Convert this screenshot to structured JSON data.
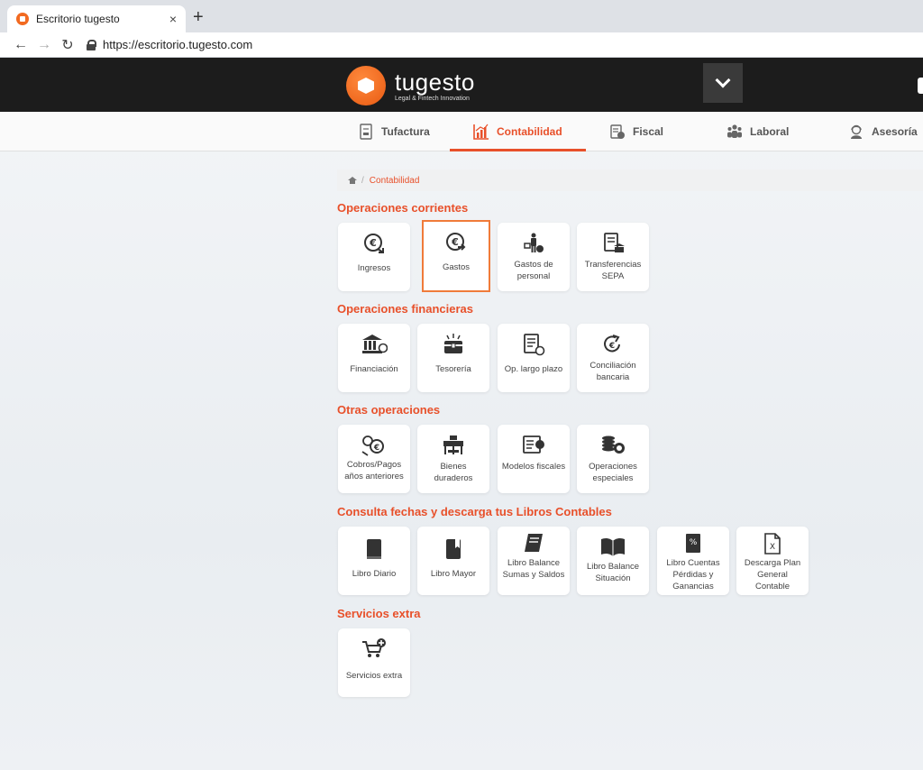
{
  "browser": {
    "tab_title": "Escritorio tugesto",
    "tab_close": "×",
    "new_tab": "+",
    "url": "https://escritorio.tugesto.com",
    "back": "←",
    "forward": "→",
    "reload": "↻"
  },
  "header": {
    "logo_name": "tugesto",
    "logo_tagline": "Legal & Fintech Innovation",
    "accent_color": "#e8502a"
  },
  "modules": [
    {
      "label": "Tufactura",
      "icon": "invoice-icon",
      "active": false
    },
    {
      "label": "Contabilidad",
      "icon": "chart-icon",
      "active": true
    },
    {
      "label": "Fiscal",
      "icon": "fiscal-doc-icon",
      "active": false
    },
    {
      "label": "Laboral",
      "icon": "people-icon",
      "active": false
    },
    {
      "label": "Asesoría",
      "icon": "advisor-icon",
      "active": false
    }
  ],
  "breadcrumb": {
    "current": "Contabilidad"
  },
  "sections": [
    {
      "title": "Operaciones corrientes",
      "items": [
        {
          "label": "Ingresos",
          "icon": "euro-in-icon"
        },
        {
          "label": "Gastos",
          "icon": "euro-out-icon",
          "selected": true
        },
        {
          "label": "Gastos de personal",
          "icon": "personnel-expense-icon"
        },
        {
          "label": "Transferencias SEPA",
          "icon": "sepa-transfer-icon"
        }
      ]
    },
    {
      "title": "Operaciones financieras",
      "items": [
        {
          "label": "Financiación",
          "icon": "bank-icon"
        },
        {
          "label": "Tesorería",
          "icon": "treasury-chest-icon"
        },
        {
          "label": "Op. largo plazo",
          "icon": "long-term-doc-icon"
        },
        {
          "label": "Conciliación bancaria",
          "icon": "reconcile-icon"
        }
      ]
    },
    {
      "title": "Otras operaciones",
      "items": [
        {
          "label": "Cobros/Pagos años anteriores",
          "icon": "previous-years-icon"
        },
        {
          "label": "Bienes duraderos",
          "icon": "durable-goods-icon"
        },
        {
          "label": "Modelos fiscales",
          "icon": "tax-model-icon"
        },
        {
          "label": "Operaciones especiales",
          "icon": "coins-icon"
        }
      ]
    },
    {
      "title": "Consulta fechas y descarga tus Libros Contables",
      "items": [
        {
          "label": "Libro Diario",
          "icon": "book-icon"
        },
        {
          "label": "Libro Mayor",
          "icon": "book-bookmark-icon"
        },
        {
          "label": "Libro Balance Sumas y Saldos",
          "icon": "book-tilted-icon"
        },
        {
          "label": "Libro Balance Situación",
          "icon": "open-book-icon"
        },
        {
          "label": "Libro Cuentas Pérdidas y Ganancias",
          "icon": "percent-book-icon"
        },
        {
          "label": "Descarga Plan General Contable",
          "icon": "excel-file-icon"
        }
      ]
    },
    {
      "title": "Servicios extra",
      "items": [
        {
          "label": "Servicios extra",
          "icon": "cart-plus-icon"
        }
      ]
    }
  ]
}
